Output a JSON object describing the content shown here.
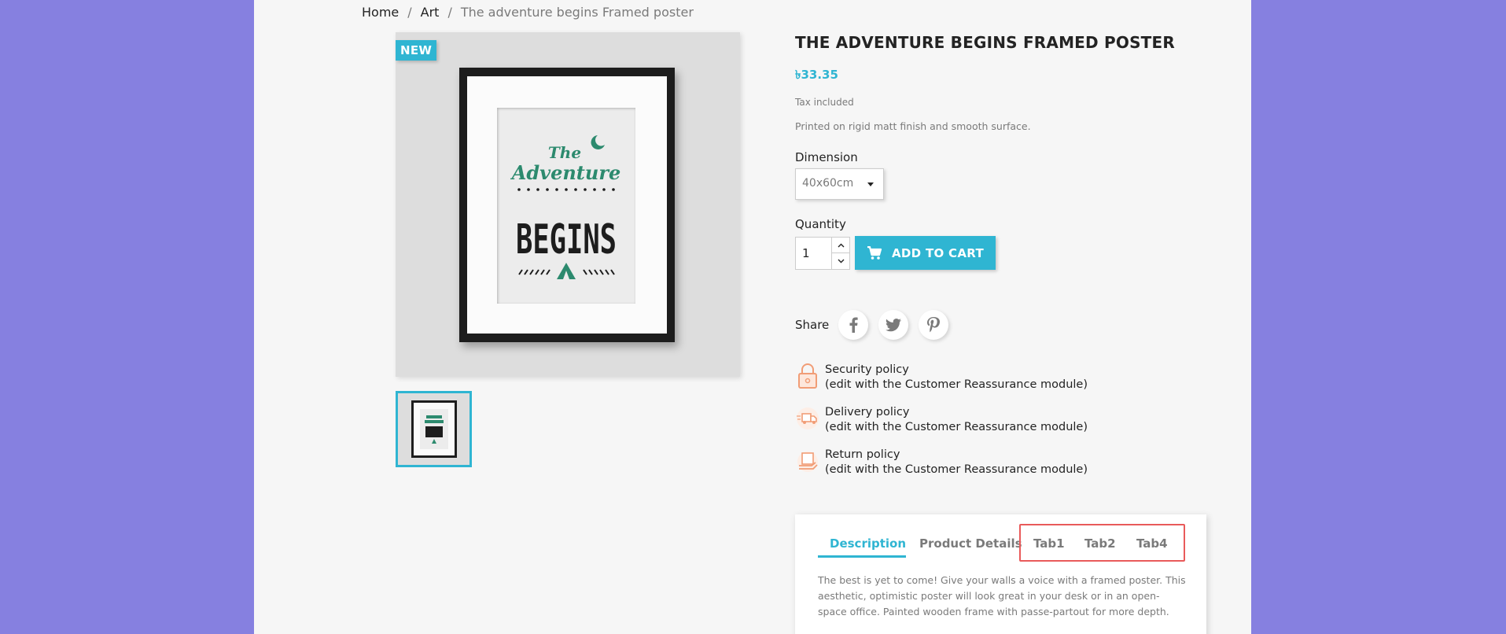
{
  "breadcrumb": {
    "items": [
      "Home",
      "Art"
    ],
    "current": "The adventure begins Framed poster"
  },
  "product": {
    "badge": "NEW",
    "title": "THE ADVENTURE BEGINS FRAMED POSTER",
    "price": "৳33.35",
    "tax_note": "Tax included",
    "short_description": "Printed on rigid matt finish and smooth surface.",
    "poster_text": {
      "line1": "The",
      "line2": "Adventure",
      "line3": "BEGINS"
    }
  },
  "variant": {
    "label": "Dimension",
    "selected": "40x60cm"
  },
  "quantity": {
    "label": "Quantity",
    "value": "1"
  },
  "cart": {
    "add_label": "ADD TO CART"
  },
  "share": {
    "label": "Share",
    "networks": [
      "facebook-icon",
      "twitter-icon",
      "pinterest-icon"
    ]
  },
  "reassurance": [
    {
      "title": "Security policy",
      "subtitle": "(edit with the Customer Reassurance module)",
      "icon": "lock-icon"
    },
    {
      "title": "Delivery policy",
      "subtitle": "(edit with the Customer Reassurance module)",
      "icon": "truck-icon"
    },
    {
      "title": "Return policy",
      "subtitle": "(edit with the Customer Reassurance module)",
      "icon": "return-box-icon"
    }
  ],
  "tabs": {
    "items": [
      "Description",
      "Product Details",
      "Tab1",
      "Tab2",
      "Tab4"
    ],
    "active": "Description",
    "content": "The best is yet to come! Give your walls a voice with a framed poster. This aesthetic, optimistic poster will look great in your desk or in an open-space office. Painted wooden frame with passe-partout for more depth."
  },
  "colors": {
    "accent": "#2fb5d2",
    "background": "#8680e0",
    "highlight": "#e95a5a"
  }
}
